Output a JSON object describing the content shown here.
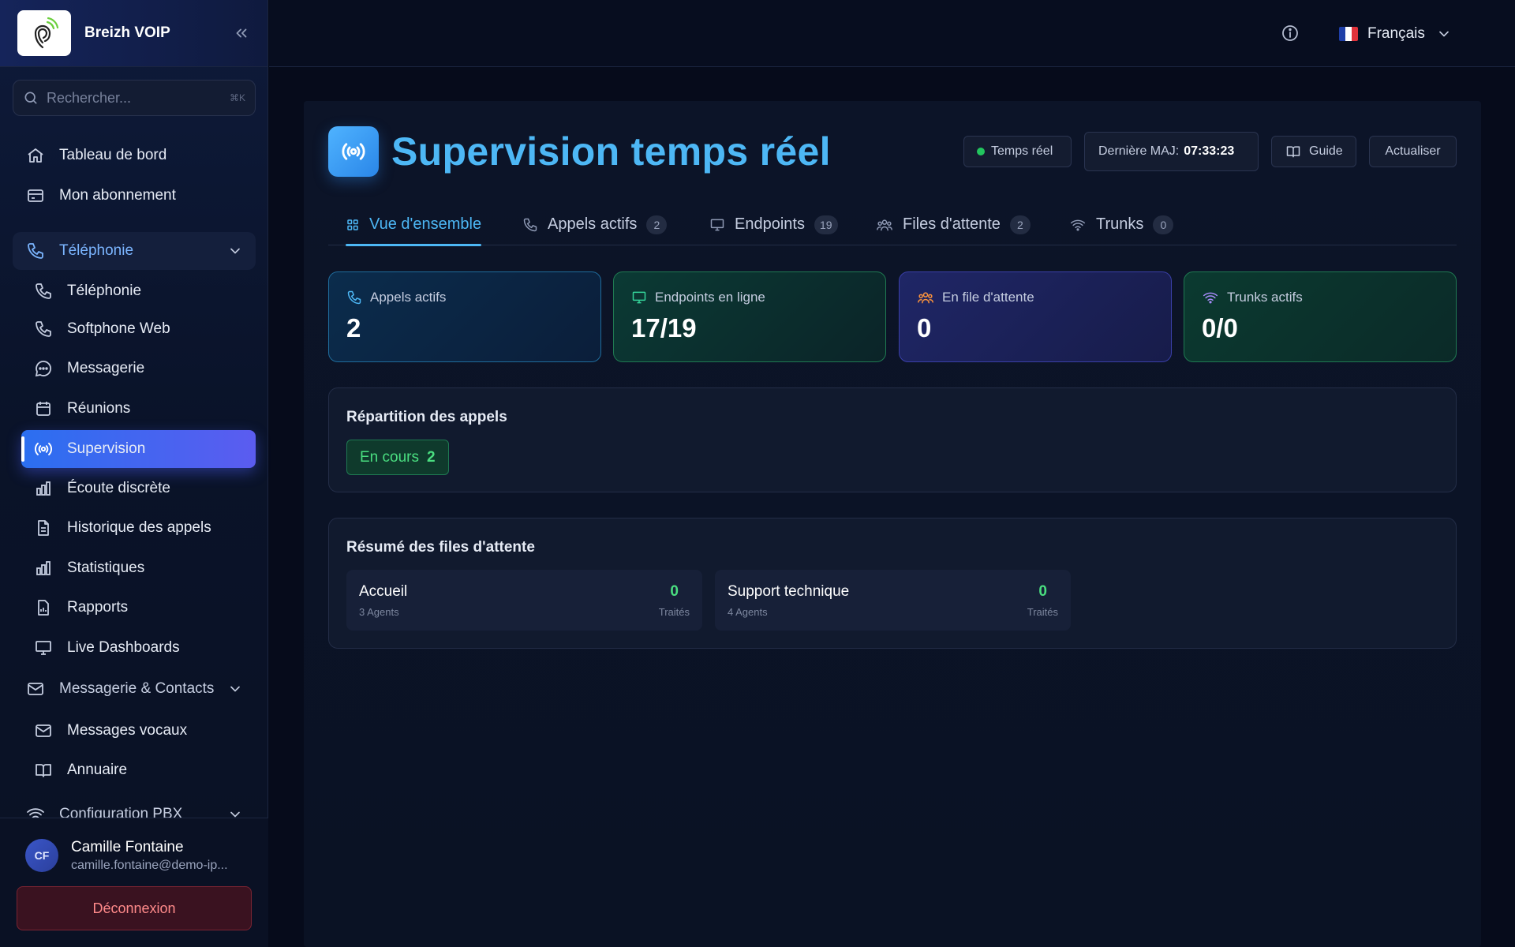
{
  "brand": {
    "name": "Breizh VOIP"
  },
  "search": {
    "placeholder": "Rechercher...",
    "shortcut": "⌘K"
  },
  "sidebar": {
    "items": [
      {
        "label": "Tableau de bord",
        "icon": "home-icon"
      },
      {
        "label": "Mon abonnement",
        "icon": "card-icon"
      },
      {
        "label": "Téléphonie",
        "icon": "phone-icon",
        "group": true,
        "expanded": true
      },
      {
        "label": "Téléphonie",
        "icon": "phone-icon"
      },
      {
        "label": "Softphone Web",
        "icon": "phone-icon"
      },
      {
        "label": "Messagerie",
        "icon": "chat-icon"
      },
      {
        "label": "Réunions",
        "icon": "calendar-icon"
      },
      {
        "label": "Supervision",
        "icon": "broadcast-icon",
        "active": true
      },
      {
        "label": "Écoute discrète",
        "icon": "bar-chart-icon"
      },
      {
        "label": "Historique des appels",
        "icon": "document-icon"
      },
      {
        "label": "Statistiques",
        "icon": "bar-chart-icon"
      },
      {
        "label": "Rapports",
        "icon": "report-icon"
      },
      {
        "label": "Live Dashboards",
        "icon": "monitor-icon"
      },
      {
        "label": "Messagerie & Contacts",
        "icon": "mail-icon",
        "group": true
      },
      {
        "label": "Messages vocaux",
        "icon": "mail-icon"
      },
      {
        "label": "Annuaire",
        "icon": "book-icon"
      },
      {
        "label": "Configuration PBX",
        "icon": "wifi-icon",
        "group": true
      }
    ]
  },
  "user": {
    "initials": "CF",
    "name": "Camille Fontaine",
    "email": "camille.fontaine@demo-ip...",
    "logout_label": "Déconnexion"
  },
  "topbar": {
    "language": "Français"
  },
  "header": {
    "title": "Supervision temps réel",
    "live_label": "Temps réel",
    "update_label": "Dernière MAJ:",
    "update_time": "07:33:23",
    "guide_label": "Guide",
    "refresh_label": "Actualiser"
  },
  "tabs": [
    {
      "label": "Vue d'ensemble",
      "count": null,
      "active": true
    },
    {
      "label": "Appels actifs",
      "count": "2"
    },
    {
      "label": "Endpoints",
      "count": "19"
    },
    {
      "label": "Files d'attente",
      "count": "2"
    },
    {
      "label": "Trunks",
      "count": "0"
    }
  ],
  "stats": [
    {
      "label": "Appels actifs",
      "value": "2"
    },
    {
      "label": "Endpoints en ligne",
      "value": "17/19"
    },
    {
      "label": "En file d'attente",
      "value": "0"
    },
    {
      "label": "Trunks actifs",
      "value": "0/0"
    }
  ],
  "distribution": {
    "title": "Répartition des appels",
    "chip_label": "En cours",
    "chip_value": "2"
  },
  "queues": {
    "title": "Résumé des files d'attente",
    "items": [
      {
        "name": "Accueil",
        "agents": "3 Agents",
        "treated": "0",
        "treated_label": "Traités"
      },
      {
        "name": "Support technique",
        "agents": "4 Agents",
        "treated": "0",
        "treated_label": "Traités"
      }
    ]
  },
  "colors": {
    "accent": "#4db7f5",
    "active_nav": "#3b6cf0",
    "success": "#4ade80",
    "danger": "#ff8a8a"
  }
}
